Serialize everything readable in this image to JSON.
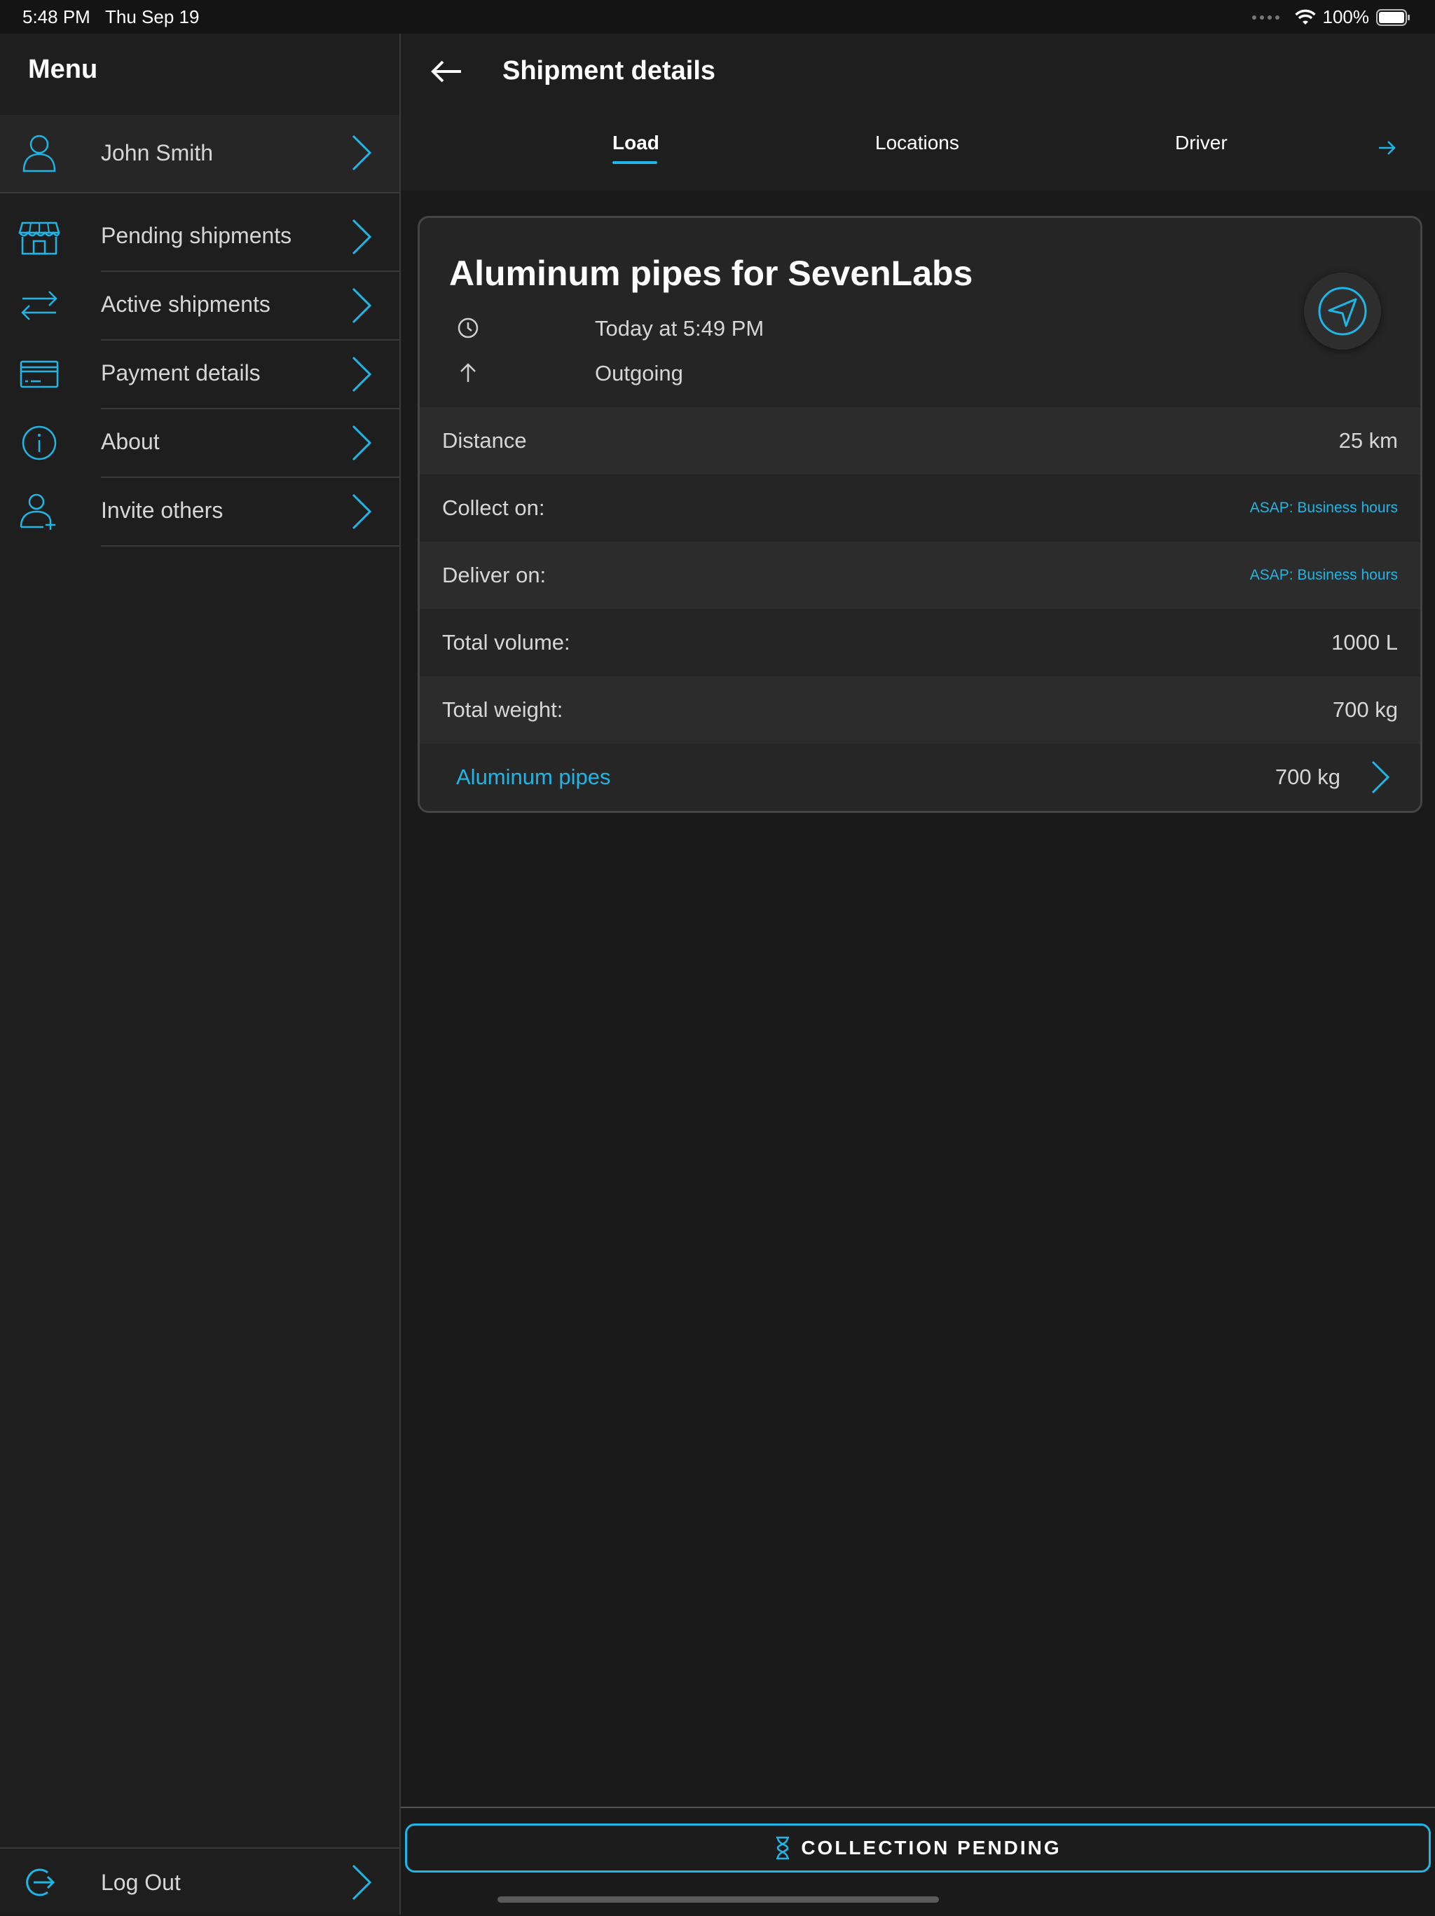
{
  "status_bar": {
    "time": "5:48 PM",
    "date": "Thu Sep 19",
    "battery": "100%"
  },
  "sidebar": {
    "title": "Menu",
    "profile": {
      "name": "John Smith",
      "icon": "user-icon"
    },
    "items": [
      {
        "label": "Pending shipments",
        "icon": "store-icon"
      },
      {
        "label": "Active shipments",
        "icon": "swap-arrows-icon"
      },
      {
        "label": "Payment details",
        "icon": "card-icon"
      },
      {
        "label": "About",
        "icon": "info-icon"
      },
      {
        "label": "Invite others",
        "icon": "add-user-icon"
      }
    ],
    "logout": {
      "label": "Log Out",
      "icon": "logout-icon"
    }
  },
  "header": {
    "title": "Shipment details",
    "tabs": [
      {
        "label": "Load",
        "active": true
      },
      {
        "label": "Locations",
        "active": false
      },
      {
        "label": "Driver",
        "active": false
      }
    ]
  },
  "shipment": {
    "title": "Aluminum pipes for SevenLabs",
    "time": "Today at 5:49 PM",
    "direction": "Outgoing",
    "details": [
      {
        "label": "Distance",
        "value": "25 km"
      },
      {
        "label": "Collect on:",
        "value": "ASAP: Business hours"
      },
      {
        "label": "Deliver on:",
        "value": "ASAP: Business hours"
      },
      {
        "label": "Total volume:",
        "value": "1000 L"
      },
      {
        "label": "Total weight:",
        "value": "700 kg"
      }
    ],
    "items": [
      {
        "name": "Aluminum pipes",
        "weight": "700 kg"
      }
    ]
  },
  "action": {
    "label": "COLLECTION PENDING",
    "icon": "hourglass-icon"
  },
  "colors": {
    "accent": "#1eb6e6",
    "background": "#1a1a1a",
    "panel": "#252525"
  }
}
